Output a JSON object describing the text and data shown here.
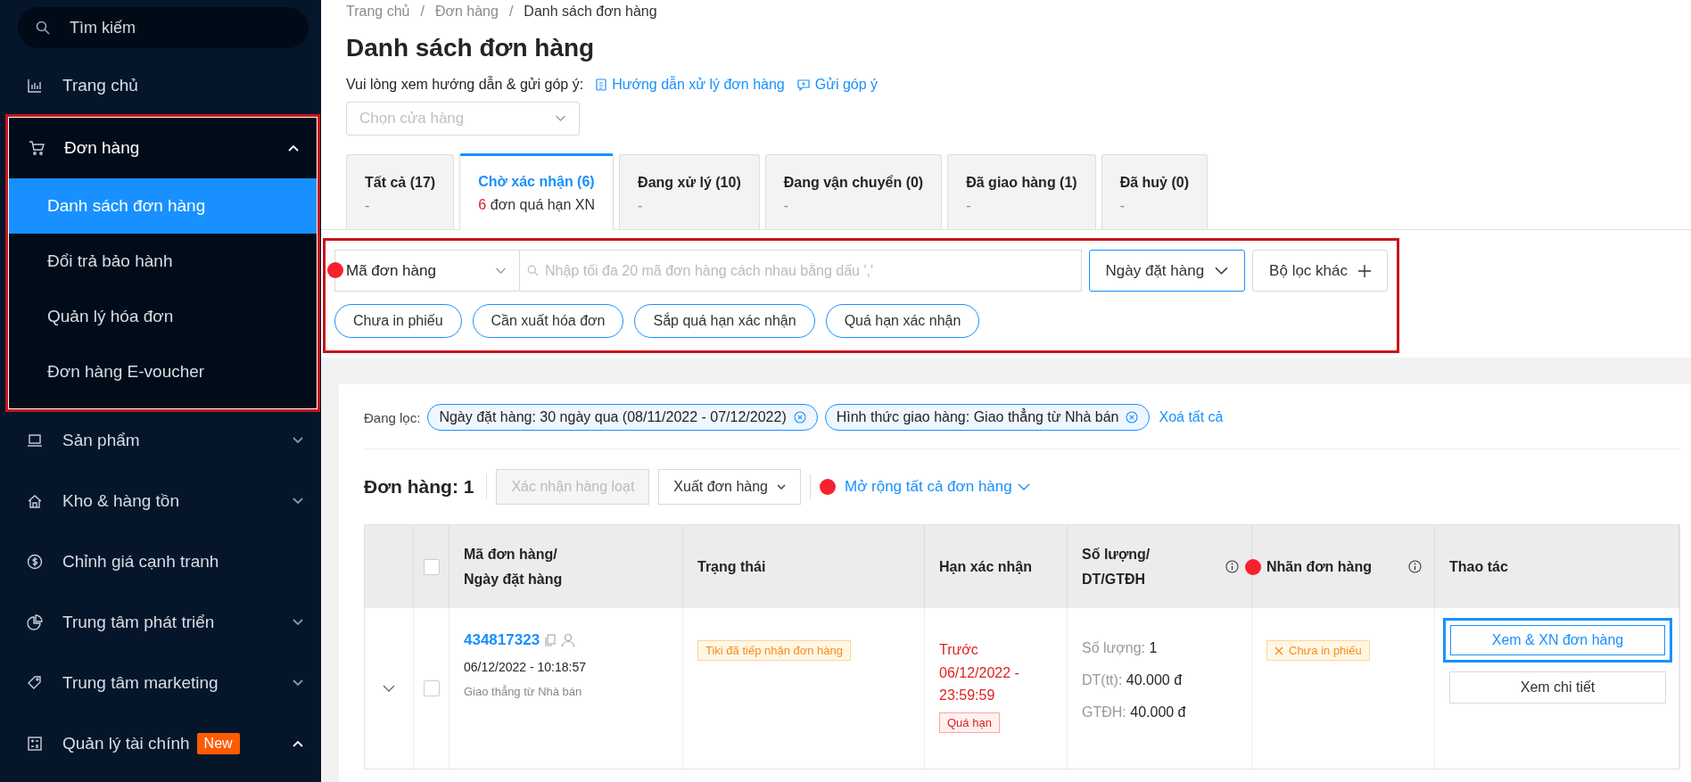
{
  "sidebar": {
    "search_placeholder": "Tìm kiếm",
    "items": [
      {
        "label": "Trang chủ",
        "highlighted": false
      },
      {
        "label": "Đơn hàng",
        "expanded": true,
        "highlighted": true,
        "children": [
          {
            "label": "Danh sách đơn hàng",
            "selected": true
          },
          {
            "label": "Đổi trả bảo hành",
            "selected": false
          },
          {
            "label": "Quản lý hóa đơn",
            "selected": false
          },
          {
            "label": "Đơn hàng E-voucher",
            "selected": false
          }
        ]
      },
      {
        "label": "Sản phẩm",
        "expanded": false,
        "highlighted": false
      },
      {
        "label": "Kho & hàng tồn",
        "expanded": false,
        "highlighted": false
      },
      {
        "label": "Chỉnh giá cạnh tranh",
        "highlighted": false
      },
      {
        "label": "Trung tâm phát triển",
        "expanded": false,
        "highlighted": false
      },
      {
        "label": "Trung tâm marketing",
        "expanded": false,
        "highlighted": false
      },
      {
        "label": "Quản lý tài chính",
        "badge": "New",
        "expanded": true,
        "highlighted": false
      }
    ]
  },
  "breadcrumb": {
    "separator": "/",
    "items": [
      "Trang chủ",
      "Đơn hàng",
      "Danh sách đơn hàng"
    ]
  },
  "title": "Danh sách đơn hàng",
  "guide": {
    "text": "Vui lòng xem hướng dẫn & gửi góp ý:",
    "links": [
      "Hướng dẫn xử lý đơn hàng",
      "Gửi góp ý"
    ]
  },
  "store_select": {
    "placeholder": "Chọn cửa hàng"
  },
  "tabs": [
    {
      "label": "Tất cả (17)",
      "sub": "-",
      "selected": false
    },
    {
      "label": "Chờ xác nhận (6)",
      "sub_count": "6",
      "sub": "đơn quá hạn XN",
      "selected": true
    },
    {
      "label": "Đang xử lý (10)",
      "sub": "-",
      "selected": false
    },
    {
      "label": "Đang vận chuyển (0)",
      "sub": "-",
      "selected": false
    },
    {
      "label": "Đã giao hàng (1)",
      "sub": "-",
      "selected": false
    },
    {
      "label": "Đã huỷ (0)",
      "sub": "-",
      "selected": false
    }
  ],
  "filter_panel": {
    "highlighted": true,
    "search_by": {
      "value": "Mã đơn hàng",
      "marked": true
    },
    "search": {
      "placeholder": "Nhập tối đa 20 mã đơn hàng cách nhau bằng dấu ','"
    },
    "date_button": "Ngày đặt hàng",
    "more_button": "Bộ lọc khác",
    "quick_filters": [
      "Chưa in phiếu",
      "Cần xuất hóa đơn",
      "Sắp quá hạn xác nhận",
      "Quá hạn xác nhận"
    ]
  },
  "active_filters": {
    "label": "Đang lọc:",
    "tags": [
      "Ngày đặt hàng: 30 ngày qua (08/11/2022 - 07/12/2022)",
      "Hình thức giao hàng: Giao thẳng từ Nhà bán"
    ],
    "clear": "Xoá tất cả"
  },
  "toolbar": {
    "count": "Đơn hàng: 1",
    "buttons": [
      {
        "label": "Xác nhận hàng loạt",
        "disabled": true
      },
      {
        "label": "Xuất đơn hàng",
        "disabled": false
      }
    ],
    "expand_link": {
      "label": "Mở rộng tất cả đơn hàng",
      "marked": true
    }
  },
  "table": {
    "header_checked": false,
    "columns": [
      {
        "lines": [
          "Mã đơn hàng/",
          "Ngày đặt hàng"
        ],
        "info": false,
        "marked": false
      },
      {
        "lines": [
          "Trạng thái"
        ],
        "info": false,
        "marked": false
      },
      {
        "lines": [
          "Hạn xác nhận"
        ],
        "info": false,
        "marked": false
      },
      {
        "lines": [
          "Số lượng/",
          "DT/GTĐH"
        ],
        "info": true,
        "marked": false
      },
      {
        "lines": [
          "Nhãn đơn hàng"
        ],
        "info": true,
        "marked": true
      },
      {
        "lines": [
          "Thao tác"
        ],
        "info": false,
        "marked": false
      }
    ],
    "rows": [
      {
        "expanded": false,
        "checked": false,
        "order_id": "434817323",
        "date": "06/12/2022 - 10:18:57",
        "shipping": "Giao thẳng từ Nhà bán",
        "status": "Tiki đã tiếp nhận đơn hàng",
        "deadline": [
          "Trước",
          "06/12/2022 -",
          "23:59:59"
        ],
        "deadline_tag": "Quá hạn",
        "amounts": [
          {
            "label": "Số lượng:",
            "value": "1"
          },
          {
            "label": "DT(tt):",
            "value": "40.000 đ"
          },
          {
            "label": "GTĐH:",
            "value": "40.000 đ"
          }
        ],
        "label_tag": "Chưa in phiếu",
        "actions": [
          {
            "label": "Xem & XN đơn hàng",
            "highlighted": true
          },
          {
            "label": "Xem chi tiết",
            "highlighted": false
          }
        ]
      }
    ]
  }
}
